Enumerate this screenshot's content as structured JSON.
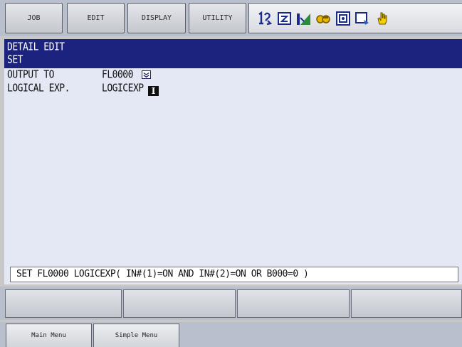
{
  "menu": {
    "job": "JOB",
    "edit": "EDIT",
    "display": "DISPLAY",
    "utility": "UTILITY"
  },
  "status_icons": [
    "step-mode-icon",
    "edit-lock-icon",
    "signal-icon",
    "key-icon",
    "teach-icon",
    "screen-icon",
    "hand-icon"
  ],
  "title": {
    "line1": "DETAIL EDIT",
    "line2": "SET"
  },
  "rows": [
    {
      "label": "OUTPUT TO",
      "value": "FL0000"
    },
    {
      "label": "LOGICAL EXP.",
      "value": "LOGICEXP"
    }
  ],
  "cursor_glyph": "I",
  "command_line": "SET FL0000 LOGICEXP( IN#(1)=ON AND IN#(2)=ON OR B000=0 )",
  "bottom": {
    "main_menu": "Main Menu",
    "simple_menu": "Simple Menu"
  },
  "colors": {
    "title_band": "#1c237e",
    "edit_area": "#e3e8f4",
    "frame": "#b9bfcc"
  }
}
